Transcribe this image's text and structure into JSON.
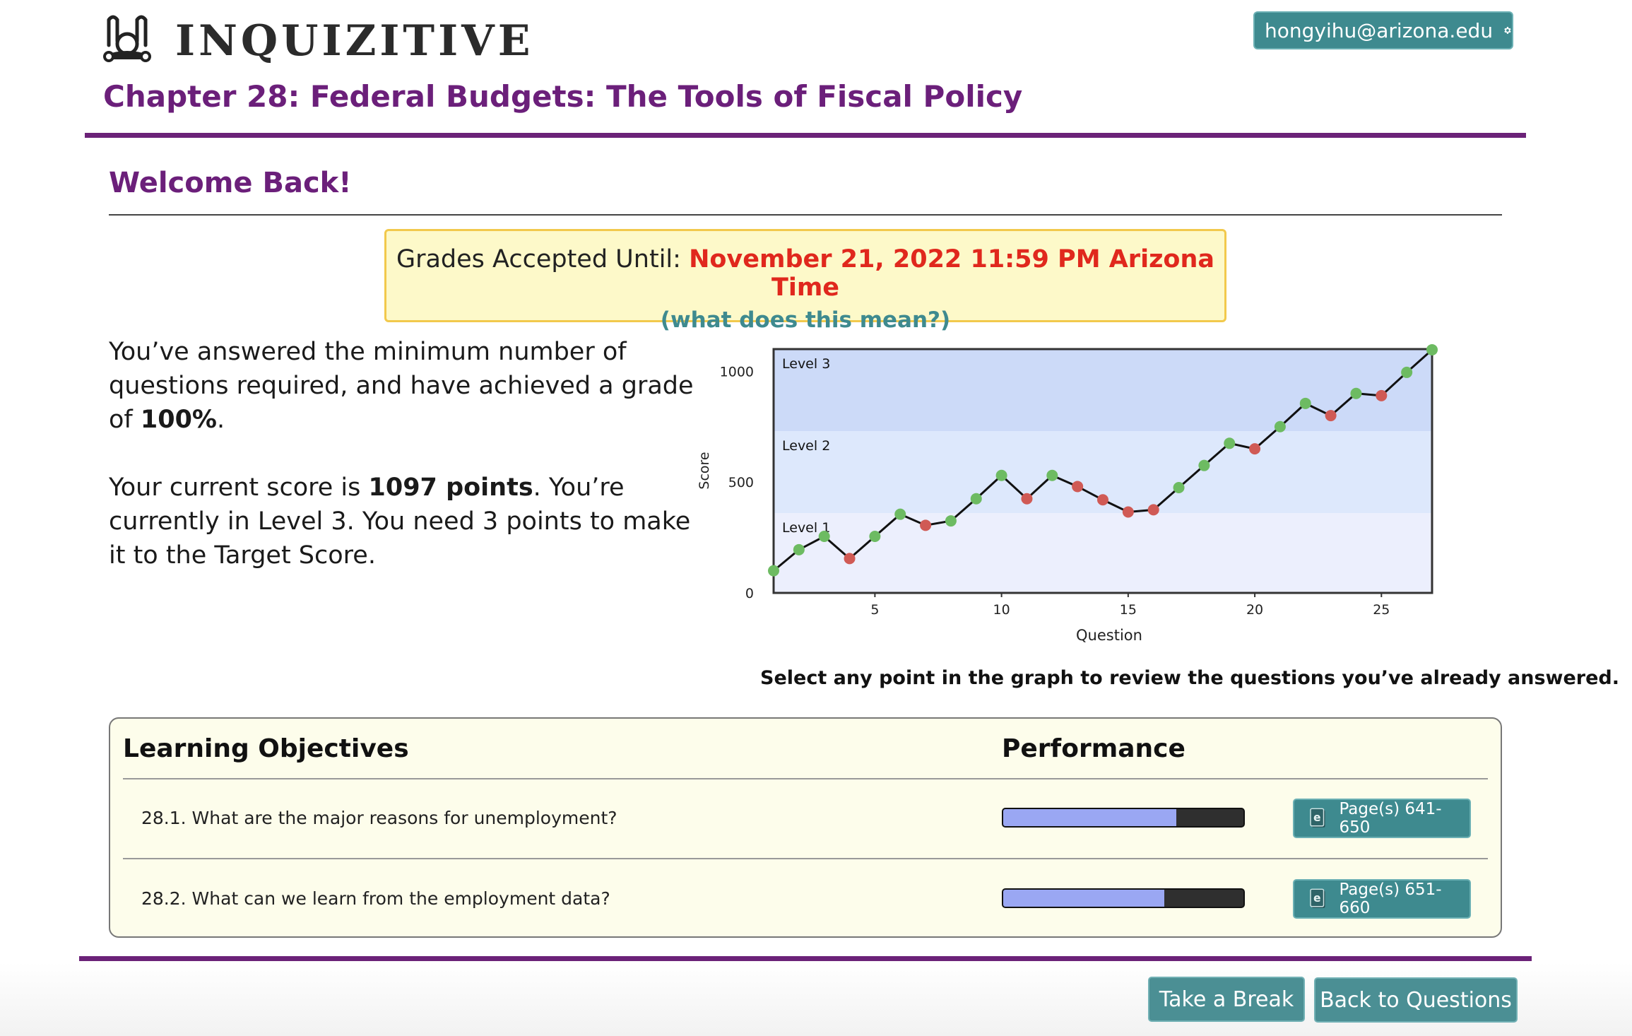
{
  "header": {
    "brand": "INQUIZITIVE",
    "user_email": "hongyihu@arizona.edu",
    "chapter_title": "Chapter 28: Federal Budgets: The Tools of Fiscal Policy"
  },
  "welcome": "Welcome Back!",
  "deadline": {
    "label": "Grades Accepted Until: ",
    "date": "November 21, 2022 11:59 PM Arizona Time",
    "help_link": "(what does this mean?)"
  },
  "summary": {
    "p1_a": "You’ve answered the minimum number of questions required, and have achieved a grade of ",
    "p1_grade": "100%",
    "p1_b": ".",
    "p2_a": "Your current score is ",
    "p2_points": "1097 points",
    "p2_b": ". You’re currently in Level 3. You need 3 points to make it to the Target Score."
  },
  "chart_data": {
    "type": "line",
    "xlabel": "Question",
    "ylabel": "Score",
    "xticks": [
      5,
      10,
      15,
      20,
      25
    ],
    "yticks": [
      0,
      500,
      1000
    ],
    "xlim": [
      1,
      27
    ],
    "ylim": [
      0,
      1100
    ],
    "bands": [
      {
        "name": "Level 1",
        "from": 0,
        "to": 360,
        "color": "#eceffd"
      },
      {
        "name": "Level 2",
        "from": 360,
        "to": 730,
        "color": "#dde8fc"
      },
      {
        "name": "Level 3",
        "from": 730,
        "to": 1100,
        "color": "#ccdaf8"
      }
    ],
    "points": [
      {
        "x": 1,
        "y": 100,
        "correct": true
      },
      {
        "x": 2,
        "y": 195,
        "correct": true
      },
      {
        "x": 3,
        "y": 255,
        "correct": true
      },
      {
        "x": 4,
        "y": 155,
        "correct": false
      },
      {
        "x": 5,
        "y": 255,
        "correct": true
      },
      {
        "x": 6,
        "y": 355,
        "correct": true
      },
      {
        "x": 7,
        "y": 305,
        "correct": false
      },
      {
        "x": 8,
        "y": 325,
        "correct": true
      },
      {
        "x": 9,
        "y": 425,
        "correct": true
      },
      {
        "x": 10,
        "y": 530,
        "correct": true
      },
      {
        "x": 11,
        "y": 425,
        "correct": false
      },
      {
        "x": 12,
        "y": 530,
        "correct": true
      },
      {
        "x": 13,
        "y": 480,
        "correct": false
      },
      {
        "x": 14,
        "y": 420,
        "correct": false
      },
      {
        "x": 15,
        "y": 365,
        "correct": false
      },
      {
        "x": 16,
        "y": 375,
        "correct": false
      },
      {
        "x": 17,
        "y": 475,
        "correct": true
      },
      {
        "x": 18,
        "y": 575,
        "correct": true
      },
      {
        "x": 19,
        "y": 675,
        "correct": true
      },
      {
        "x": 20,
        "y": 650,
        "correct": false
      },
      {
        "x": 21,
        "y": 750,
        "correct": true
      },
      {
        "x": 22,
        "y": 855,
        "correct": true
      },
      {
        "x": 23,
        "y": 800,
        "correct": false
      },
      {
        "x": 24,
        "y": 900,
        "correct": true
      },
      {
        "x": 25,
        "y": 890,
        "correct": false
      },
      {
        "x": 26,
        "y": 995,
        "correct": true
      },
      {
        "x": 27,
        "y": 1097,
        "correct": true
      }
    ],
    "colors": {
      "correct": "#6dbb62",
      "incorrect": "#d05a55",
      "line": "#111111"
    }
  },
  "chart_hint": "Select any point in the graph to review the questions you’ve already answered.",
  "objectives": {
    "col_objectives": "Learning Objectives",
    "col_performance": "Performance",
    "rows": [
      {
        "text": "28.1. What are the major reasons for unemployment?",
        "performance": 0.72,
        "pages": "Page(s) 641-650"
      },
      {
        "text": "28.2. What can we learn from the employment data?",
        "performance": 0.67,
        "pages": "Page(s) 651-660"
      }
    ]
  },
  "footer": {
    "take_break": "Take a Break",
    "back_to_questions": "Back to Questions"
  }
}
